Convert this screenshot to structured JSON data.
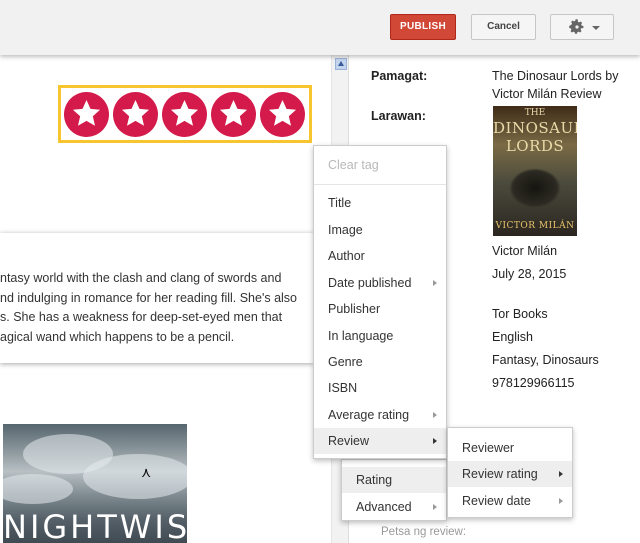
{
  "toolbar": {
    "publish_label": "PUBLISH",
    "cancel_label": "Cancel",
    "settings_icon": "gear-icon"
  },
  "editor": {
    "rating_stars": 5,
    "star_color": "#d4194b",
    "highlight_color": "#f7c62f",
    "review_excerpt": [
      "ntasy world with the clash and clang of swords and",
      "nd indulging in romance for her reading fill. She's also",
      "s. She has a weakness for deep-set-eyed men that",
      "agical wand which happens to be a pencil."
    ],
    "cover_title": "NIGHTWISE"
  },
  "sidepanel": {
    "title_label": "Pamagat:",
    "title_value_line1": "The Dinosaur Lords by",
    "title_value_line2": "Victor Milán Review",
    "image_label": "Larawan:",
    "book_cover": {
      "line1": "THE",
      "line2": "DINOSAUR",
      "line3": "LORDS",
      "author": "VICTOR MILÁN"
    },
    "author": "Victor Milán",
    "date": "July 28, 2015",
    "publisher": "Tor Books",
    "language": "English",
    "genre": "Fantasy, Dinosaurs",
    "isbn": "978129966115",
    "review_date_label": "Petsa ng review:"
  },
  "context_menu": {
    "clear_tag": "Clear tag",
    "items": [
      "Title",
      "Image",
      "Author",
      "Date published",
      "Publisher",
      "In language",
      "Genre",
      "ISBN",
      "Average rating",
      "Review"
    ]
  },
  "review_submenu": {
    "items": [
      "Reviewer",
      "Review rating",
      "Review date"
    ]
  },
  "rating_submenu": {
    "items": [
      "Rating",
      "Advanced"
    ]
  }
}
